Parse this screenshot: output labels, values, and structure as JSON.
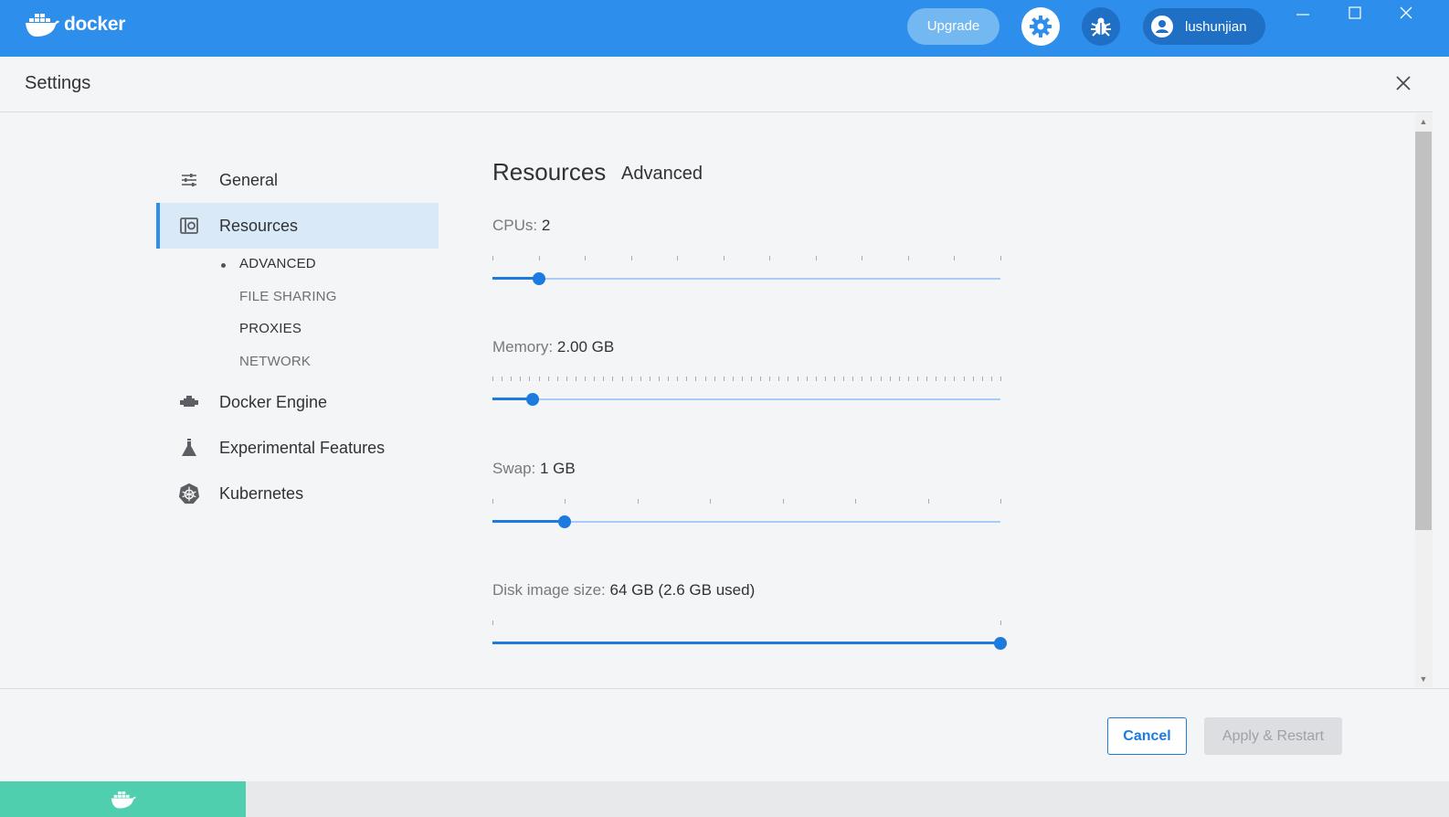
{
  "app": {
    "logo_text": "docker"
  },
  "topbar": {
    "upgrade_label": "Upgrade",
    "username": "lushunjian",
    "icons": [
      "gear-icon",
      "bug-icon",
      "user-icon"
    ],
    "brand_color": "#2d8eeb"
  },
  "header": {
    "title": "Settings"
  },
  "sidebar": {
    "items": [
      {
        "label": "General",
        "icon": "sliders-icon"
      },
      {
        "label": "Resources",
        "icon": "resources-icon",
        "active": true
      },
      {
        "label": "Docker Engine",
        "icon": "engine-icon"
      },
      {
        "label": "Experimental Features",
        "icon": "flask-icon"
      },
      {
        "label": "Kubernetes",
        "icon": "kubernetes-icon"
      }
    ],
    "sub_items": [
      {
        "label": "ADVANCED",
        "active": true
      },
      {
        "label": "FILE SHARING"
      },
      {
        "label": "PROXIES"
      },
      {
        "label": "NETWORK"
      }
    ]
  },
  "main": {
    "title": "Resources",
    "subtitle": "Advanced",
    "cpus": {
      "label": "CPUs:",
      "value": "2",
      "min": 1,
      "max": 12,
      "current": 2
    },
    "memory": {
      "label": "Memory:",
      "value": "2.00 GB",
      "level": 0.08
    },
    "swap": {
      "label": "Swap:",
      "value": "1 GB",
      "min": 0,
      "max": 7,
      "current": 1
    },
    "disk": {
      "label": "Disk image size:",
      "value": "64 GB (2.6 GB used)",
      "level": 1.0
    }
  },
  "footer": {
    "cancel_label": "Cancel",
    "apply_label": "Apply & Restart"
  },
  "statusbar": {
    "icon": "whale-icon",
    "color": "#4fcfae"
  }
}
